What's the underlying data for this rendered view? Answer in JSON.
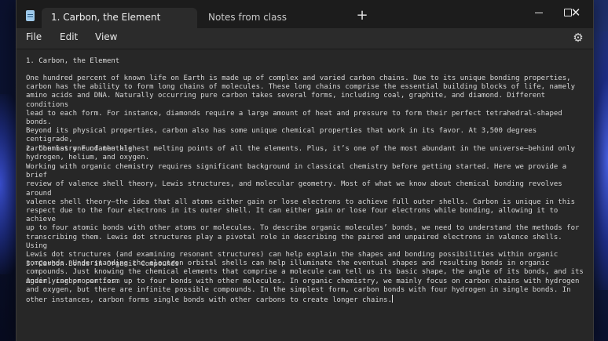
{
  "tabs": [
    {
      "label": "1. Carbon, the Element",
      "active": true
    },
    {
      "label": "Notes from class",
      "active": false
    }
  ],
  "window_controls": {
    "add_tab": "+",
    "close": "✕"
  },
  "menu": [
    "File",
    "Edit",
    "View"
  ],
  "document": {
    "heading1": "1. Carbon, the Element",
    "para1": "One hundred percent of known life on Earth is made up of complex and varied carbon chains. Due to its unique bonding properties,\ncarbon has the ability to form long chains of molecules. These long chains comprise the essential building blocks of life, namely\namino acids and DNA. Naturally occurring pure carbon takes several forms, including coal, graphite, and diamond. Different conditions\nlead to each form. For instance, diamonds require a large amount of heat and pressure to form their perfect tetrahedral-shaped bonds.\nBeyond its physical properties, carbon also has some unique chemical properties that work in its favor. At 3,500 degrees centigrade,\ncarbon has one of the highest melting points of all the elements. Plus, it’s one of the most abundant in the universe—behind only\nhydrogen, helium, and oxygen.",
    "heading2": "2. Chemistry Fundamentals",
    "para2": "Working with organic chemistry requires significant background in classical chemistry before getting started. Here we provide a brief\nreview of valence shell theory, Lewis structures, and molecular geometry. Most of what we know about chemical bonding revolves around\nvalence shell theory—the idea that all atoms either gain or lose electrons to achieve full outer shells. Carbon is unique in this\nrespect due to the four electrons in its outer shell. It can either gain or lose four electrons while bonding, allowing it to achieve\nup to four atomic bonds with other atoms or molecules. To describe organic molecules’ bonds, we need to understand the methods for\ntranscribing them. Lewis dot structures play a pivotal role in describing the paired and unpaired electrons in valence shells. Using\nLewis dot structures (and examining resonant structures) can help explain the shapes and bonding possibilities within organic\ncompounds. Understanding the electron orbital shells can help illuminate the eventual shapes and resulting bonds in organic\ncompounds. Just knowing the chemical elements that comprise a molecule can tell us its basic shape, the angle of its bonds, and its\nunderlying properties.",
    "heading3": "3. Carbon Bonds in Organic Compounds",
    "para3": "Again, carbon can form up to four bonds with other molecules. In organic chemistry, we mainly focus on carbon chains with hydrogen\nand oxygen, but there are infinite possible compounds. In the simplest form, carbon bonds with four hydrogen in single bonds. In\nother instances, carbon forms single bonds with other carbons to create longer chains."
  },
  "icons": [
    "notepad-icon",
    "minimize-icon",
    "maximize-icon",
    "close-icon",
    "settings-gear-icon"
  ]
}
